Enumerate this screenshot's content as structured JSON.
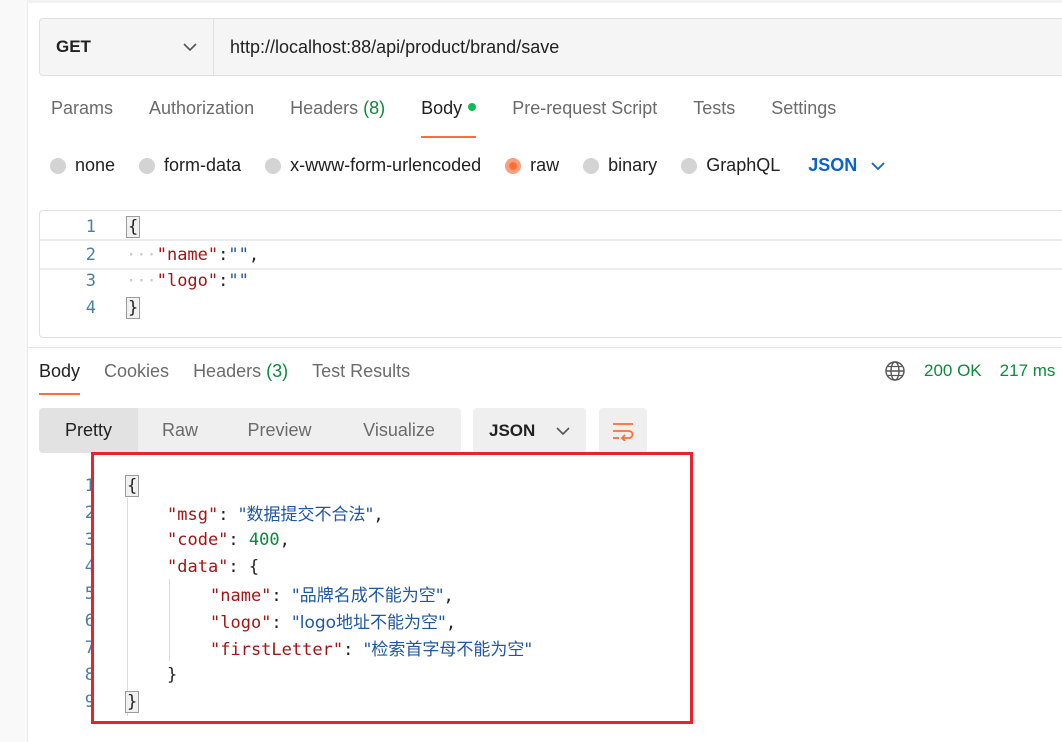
{
  "request": {
    "method": "GET",
    "url": "http://localhost:88/api/product/brand/save",
    "tabs": [
      {
        "label": "Params"
      },
      {
        "label": "Authorization"
      },
      {
        "label": "Headers",
        "count": "(8)"
      },
      {
        "label": "Body"
      },
      {
        "label": "Pre-request Script"
      },
      {
        "label": "Tests"
      },
      {
        "label": "Settings"
      }
    ],
    "body_types": [
      "none",
      "form-data",
      "x-www-form-urlencoded",
      "raw",
      "binary",
      "GraphQL"
    ],
    "selected_body_type": "raw",
    "body_language": "JSON",
    "editor_lines": [
      {
        "n": "1",
        "text": "{"
      },
      {
        "n": "2",
        "key": "\"name\"",
        "value": "\"\"",
        "suffix": ","
      },
      {
        "n": "3",
        "key": "\"logo\"",
        "value": "\"\""
      },
      {
        "n": "4",
        "text": "}"
      }
    ]
  },
  "response": {
    "tabs": [
      {
        "label": "Body"
      },
      {
        "label": "Cookies"
      },
      {
        "label": "Headers",
        "count": "(3)"
      },
      {
        "label": "Test Results"
      }
    ],
    "status": "200 OK",
    "time": "217 ms",
    "views": [
      "Pretty",
      "Raw",
      "Preview",
      "Visualize"
    ],
    "language": "JSON",
    "lines": [
      {
        "n": "1",
        "text": "{"
      },
      {
        "n": "2",
        "key": "\"msg\"",
        "value": "\"数据提交不合法\"",
        "suffix": ","
      },
      {
        "n": "3",
        "key": "\"code\"",
        "value": "400",
        "suffix": ","
      },
      {
        "n": "4",
        "key": "\"data\"",
        "text": "{"
      },
      {
        "n": "5",
        "key": "\"name\"",
        "value": "\"品牌名成不能为空\"",
        "suffix": ","
      },
      {
        "n": "6",
        "key": "\"logo\"",
        "value": "\"logo地址不能为空\"",
        "suffix": ","
      },
      {
        "n": "7",
        "key": "\"firstLetter\"",
        "value": "\"检索首字母不能为空\""
      },
      {
        "n": "8",
        "text": "}"
      },
      {
        "n": "9",
        "text": "}"
      }
    ]
  },
  "colors": {
    "accent": "#ff6c37",
    "status_ok": "#0a8a3a",
    "highlight_box": "#e8232d",
    "link_blue": "#0b64c9"
  }
}
